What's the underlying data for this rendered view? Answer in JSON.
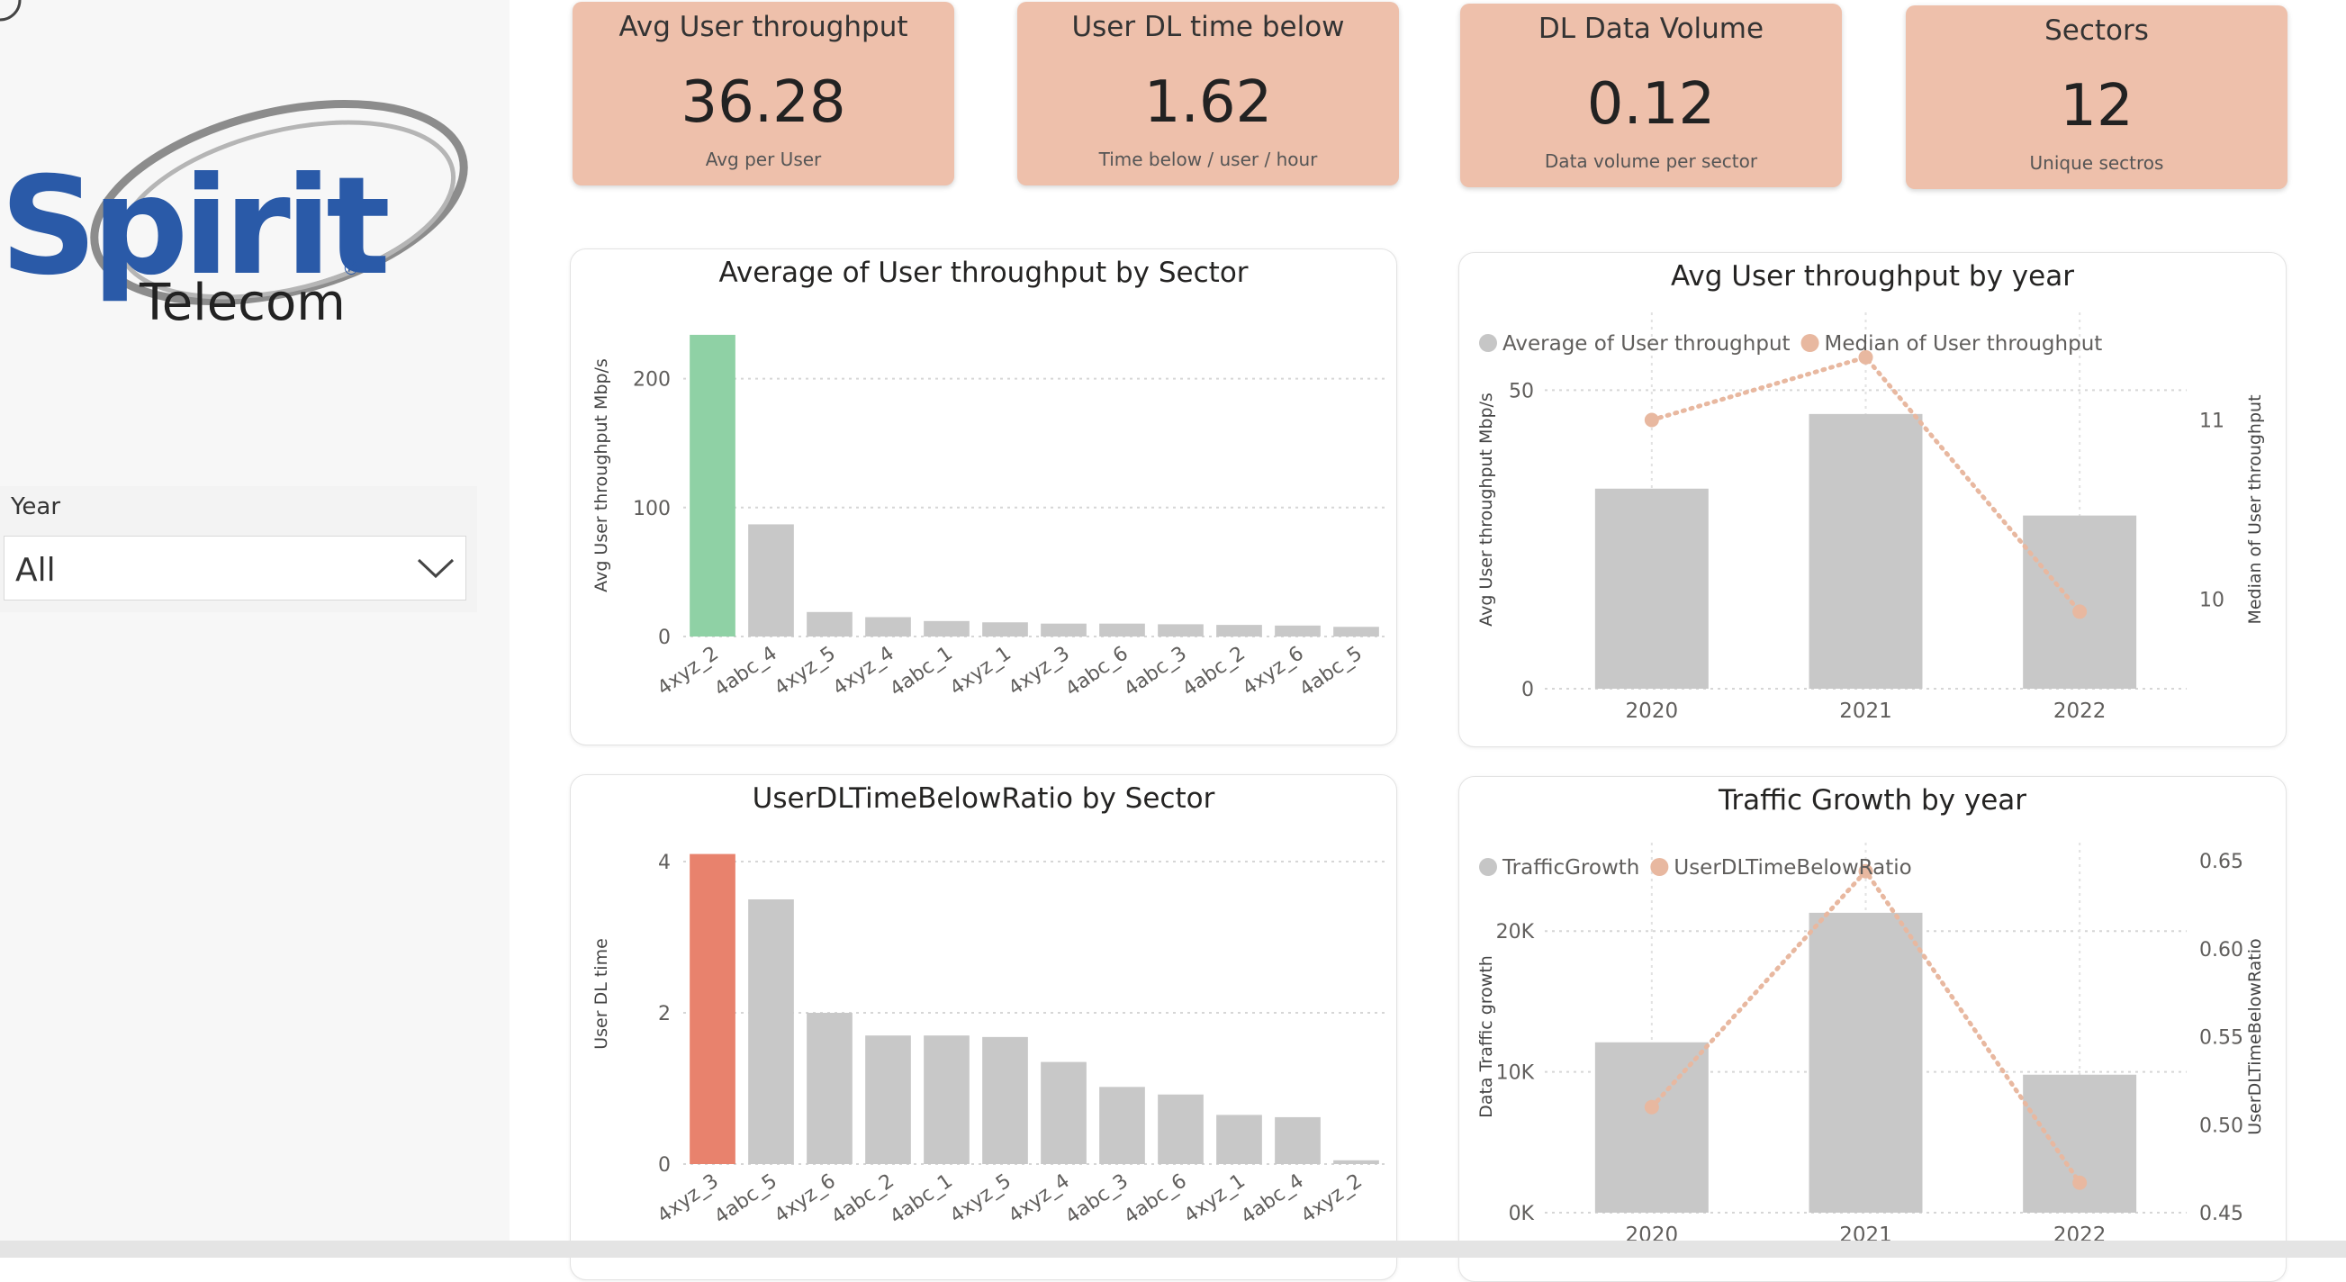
{
  "colors": {
    "kpi_bg": "#eec0ab",
    "bar_gray": "#c8c8c8",
    "highlight_green": "#8fd1a5",
    "highlight_red": "#e8826d",
    "line_peach": "#e8b8a0"
  },
  "logo": {
    "brand": "Spirit",
    "sub": "Telecom",
    "reg": "®"
  },
  "filter": {
    "label": "Year",
    "value": "All",
    "icon": "chevron-down-icon"
  },
  "kpis": [
    {
      "title": "Avg User throughput",
      "value": "36.28",
      "sub": "Avg per User"
    },
    {
      "title": "User DL time below",
      "value": "1.62",
      "sub": "Time below / user / hour"
    },
    {
      "title": "DL Data Volume",
      "value": "0.12",
      "sub": "Data volume per sector"
    },
    {
      "title": "Sectors",
      "value": "12",
      "sub": "Unique sectros"
    }
  ],
  "chart_data": [
    {
      "type": "bar",
      "title": "Average of User throughput by Sector",
      "ylabel": "Avg User throughput Mbp/s",
      "xlabel": "",
      "ylim": [
        0,
        250
      ],
      "yticks": [
        0,
        100,
        200
      ],
      "categories": [
        "4xyz_2",
        "4abc_4",
        "4xyz_5",
        "4xyz_4",
        "4abc_1",
        "4xyz_1",
        "4xyz_3",
        "4abc_6",
        "4abc_3",
        "4abc_2",
        "4xyz_6",
        "4abc_5"
      ],
      "values": [
        234,
        87,
        19,
        15,
        12,
        11,
        10,
        10,
        9.5,
        9,
        8.5,
        7.5
      ],
      "highlight_index": 0,
      "highlight_color": "#8fd1a5",
      "grid": true
    },
    {
      "type": "bar+line",
      "title": "Avg User throughput by year",
      "ylabel": "Avg User throughput Mbp/s",
      "y2label": "Median of User throughput",
      "categories": [
        "2020",
        "2021",
        "2022"
      ],
      "ylim": [
        0,
        60
      ],
      "yticks": [
        0,
        50
      ],
      "y2lim": [
        9.5,
        11.5
      ],
      "y2ticks": [
        10,
        11
      ],
      "series": [
        {
          "name": "Average of User throughput",
          "type": "bar",
          "values": [
            33.5,
            46,
            29
          ]
        },
        {
          "name": "Median of User throughput",
          "type": "line",
          "values": [
            11.0,
            11.35,
            9.93
          ]
        }
      ],
      "legend": "top-left"
    },
    {
      "type": "bar",
      "title": "UserDLTimeBelowRatio by Sector",
      "ylabel": "User DL time",
      "xlabel": "",
      "ylim": [
        0,
        4.5
      ],
      "yticks": [
        0,
        2,
        4
      ],
      "categories": [
        "4xyz_3",
        "4abc_5",
        "4xyz_6",
        "4abc_2",
        "4abc_1",
        "4xyz_5",
        "4xyz_4",
        "4abc_3",
        "4abc_6",
        "4xyz_1",
        "4abc_4",
        "4xyz_2"
      ],
      "values": [
        4.1,
        3.5,
        2.0,
        1.7,
        1.7,
        1.68,
        1.35,
        1.02,
        0.92,
        0.65,
        0.62,
        0.05
      ],
      "highlight_index": 0,
      "highlight_color": "#e8826d",
      "grid": true
    },
    {
      "type": "bar+line",
      "title": "Traffic Growth by year",
      "ylabel": "Data Traffic growth",
      "y2label": "UserDLTimeBelowRatio",
      "categories": [
        "2020",
        "2021",
        "2022"
      ],
      "ylim": [
        0,
        25000
      ],
      "yticks": [
        0,
        10000,
        20000
      ],
      "ytick_labels": [
        "0K",
        "10K",
        "20K"
      ],
      "y2lim": [
        0.45,
        0.65
      ],
      "y2ticks": [
        0.45,
        0.5,
        0.55,
        0.6,
        0.65
      ],
      "y2tick_labels": [
        "0.45",
        "0.50",
        "0.55",
        "0.60",
        "0.65"
      ],
      "series": [
        {
          "name": "TrafficGrowth",
          "type": "bar",
          "values": [
            12100,
            21300,
            9800
          ]
        },
        {
          "name": "UserDLTimeBelowRatio",
          "type": "line",
          "values": [
            0.51,
            0.644,
            0.467
          ]
        }
      ],
      "legend": "top-left"
    }
  ]
}
